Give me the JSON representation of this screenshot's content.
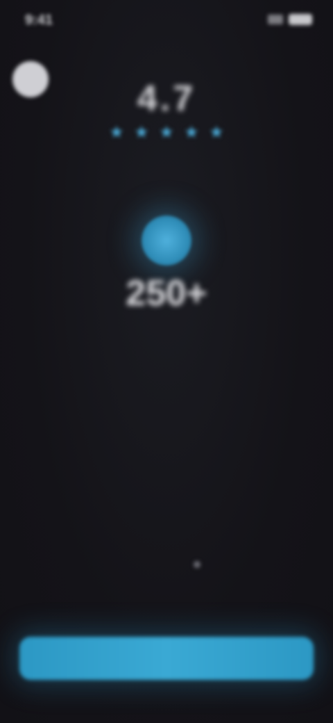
{
  "status_bar": {
    "time": "9:41",
    "icons": [
      "signal-icon",
      "battery-icon"
    ]
  },
  "profile": {
    "avatar_icon": "avatar-icon"
  },
  "rating": {
    "value": "4.7",
    "stars": 5,
    "caption": ""
  },
  "stat": {
    "icon": "badge-icon",
    "value": "250+",
    "caption": ""
  },
  "onboarding": {
    "headline": "",
    "subtext": ""
  },
  "pager": {
    "current": 1
  },
  "cta": {
    "label": ""
  },
  "colors": {
    "background": "#141318",
    "accent": "#3aa9d4",
    "text": "#e8e8ea",
    "muted": "#55555d"
  }
}
